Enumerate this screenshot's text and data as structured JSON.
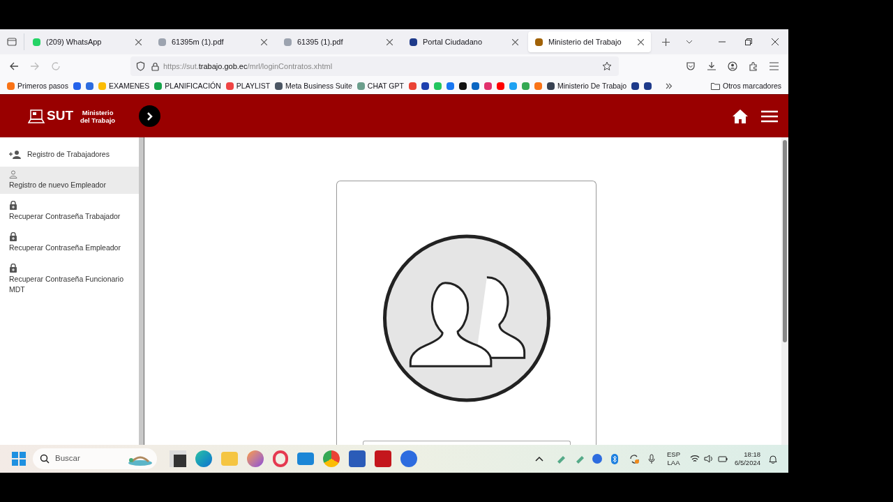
{
  "tabs": [
    {
      "label": "(209) WhatsApp",
      "selected": false,
      "color": "#25d366"
    },
    {
      "label": "61395m (1).pdf",
      "selected": false,
      "color": "#9ca3af"
    },
    {
      "label": "61395 (1).pdf",
      "selected": false,
      "color": "#9ca3af"
    },
    {
      "label": "Portal Ciudadano",
      "selected": false,
      "color": "#1e3a8a"
    },
    {
      "label": "Ministerio del Trabajo",
      "selected": true,
      "color": "#a16207"
    }
  ],
  "address_bar": {
    "url_prefix": "https://sut.",
    "url_domain": "trabajo.gob.ec",
    "url_path": "/mrl/loginContratos.xhtml"
  },
  "bookmarks": [
    {
      "kind": "link",
      "label": "Primeros pasos",
      "color": "#f97316"
    },
    {
      "kind": "icon",
      "color": "#2563eb"
    },
    {
      "kind": "icon",
      "color": "#2d6cdf"
    },
    {
      "kind": "link",
      "label": "EXAMENES",
      "color": "#fbbc04"
    },
    {
      "kind": "link",
      "label": "PLANIFICACIÓN",
      "color": "#16a34a"
    },
    {
      "kind": "link",
      "label": "PLAYLIST",
      "color": "#ef4444"
    },
    {
      "kind": "link",
      "label": "Meta Business Suite",
      "color": "#4b5563"
    },
    {
      "kind": "link",
      "label": "CHAT GPT",
      "color": "#6b9e8c"
    },
    {
      "kind": "icon",
      "color": "#ea4335"
    },
    {
      "kind": "icon",
      "color": "#1e40af"
    },
    {
      "kind": "icon",
      "color": "#22c55e"
    },
    {
      "kind": "icon",
      "color": "#1877f2"
    },
    {
      "kind": "icon",
      "color": "#111111"
    },
    {
      "kind": "icon",
      "color": "#0a66c2"
    },
    {
      "kind": "icon",
      "color": "#e1306c"
    },
    {
      "kind": "icon",
      "color": "#ff0000"
    },
    {
      "kind": "icon",
      "color": "#1da1f2"
    },
    {
      "kind": "icon",
      "color": "#34a853"
    },
    {
      "kind": "icon",
      "color": "#f97316"
    },
    {
      "kind": "link",
      "label": "Ministerio De Trabajo",
      "color": "#374151"
    },
    {
      "kind": "icon",
      "color": "#1e3a8a"
    },
    {
      "kind": "icon",
      "color": "#1e3a8a"
    }
  ],
  "other_bookmarks": "Otros marcadores",
  "header": {
    "logo": "SUT",
    "ministry_line_1": "Ministerio",
    "ministry_line_2": "del Trabajo"
  },
  "sidebar": {
    "items": [
      {
        "label": "Registro de Trabajadores",
        "kind": "add-person",
        "selected": false
      },
      {
        "label": "Registro de nuevo Empleador",
        "kind": "person",
        "selected": true
      },
      {
        "label": "Recuperar Contraseña Trabajador",
        "kind": "lock",
        "selected": false
      },
      {
        "label": "Recuperar Contraseña Empleador",
        "kind": "lock",
        "selected": false
      },
      {
        "label": "Recuperar Contraseña Funcionario MDT",
        "kind": "lock",
        "selected": false
      }
    ]
  },
  "taskbar": {
    "search_placeholder": "Buscar",
    "language": "ESP",
    "layout": "LAA",
    "time": "18:18",
    "date": "6/5/2024"
  }
}
